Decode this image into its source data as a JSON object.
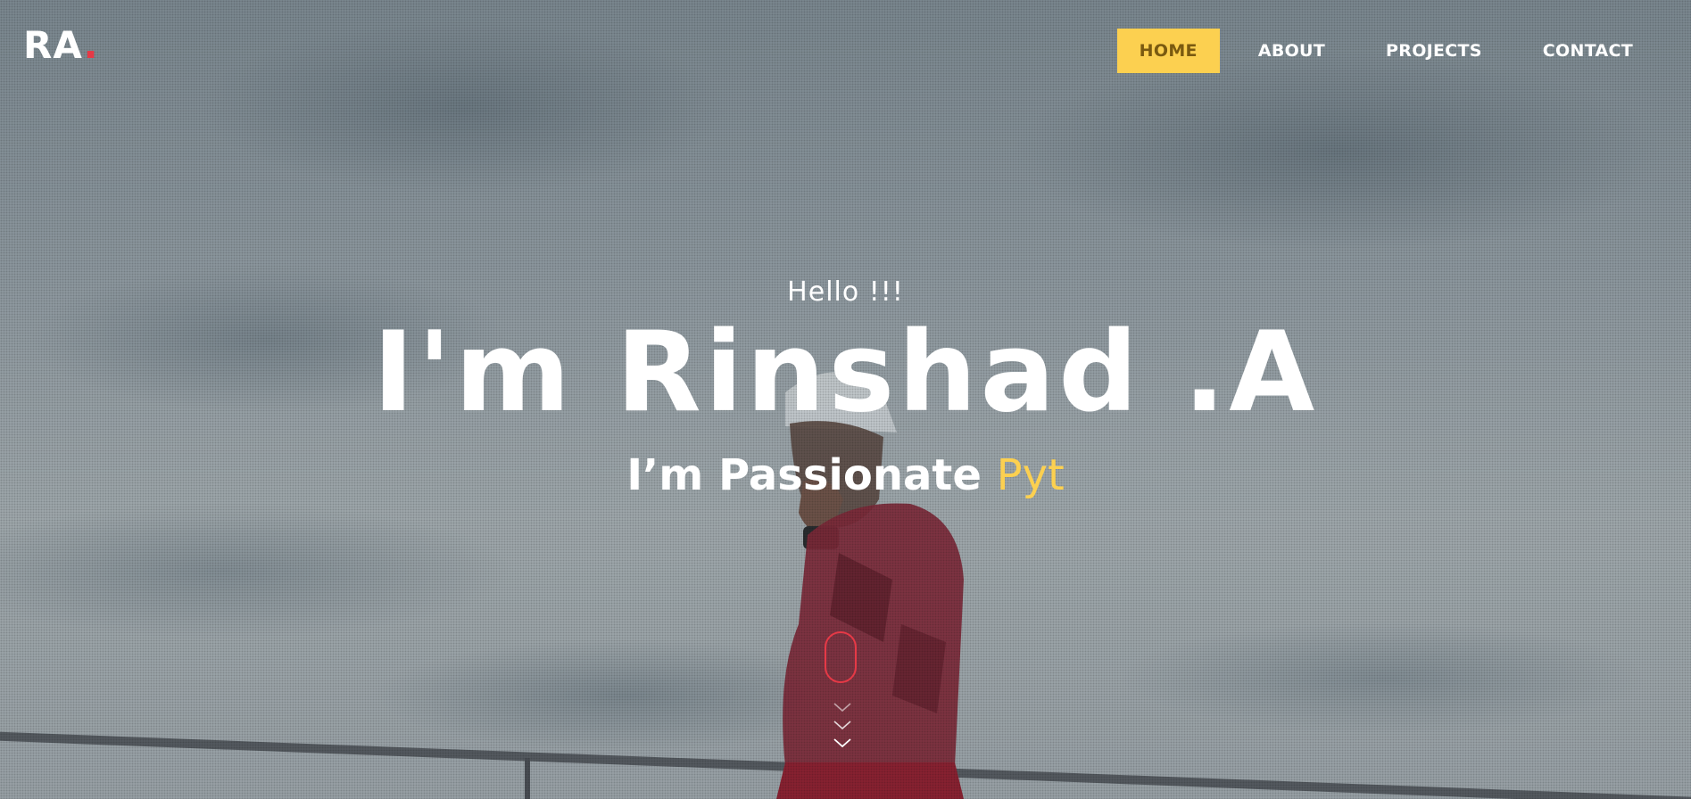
{
  "logo": {
    "text": "RA",
    "dot": "."
  },
  "nav": {
    "items": [
      {
        "label": "HOME",
        "active": true
      },
      {
        "label": "ABOUT",
        "active": false
      },
      {
        "label": "PROJECTS",
        "active": false
      },
      {
        "label": "CONTACT",
        "active": false
      }
    ]
  },
  "hero": {
    "greeting": "Hello !!!",
    "name": "I'm Rinshad .A",
    "tagline_prefix": "I’m Passionate",
    "tagline_typed": "Pyt"
  },
  "colors": {
    "accent": "#fcd050",
    "accent_text": "#7a5a10",
    "logo_dot": "#e63946",
    "scroll_indicator": "#e63946"
  },
  "icons": {
    "scroll": "mouse-scroll-icon",
    "chevrons": "chevron-down-icon"
  }
}
